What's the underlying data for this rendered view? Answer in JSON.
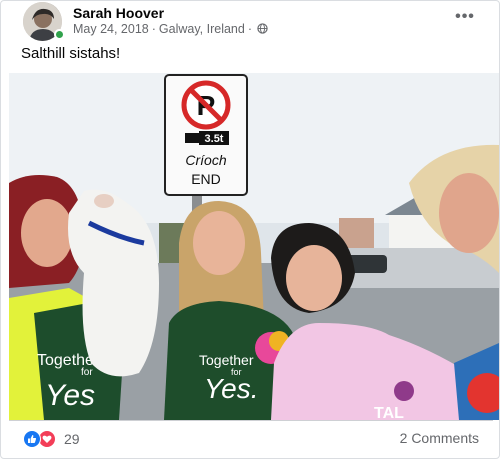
{
  "post": {
    "author": "Sarah Hoover",
    "date": "May 24, 2018",
    "separator": "·",
    "location": "Galway, Ireland",
    "caption": "Salthill sistahs!",
    "more_menu": "•••",
    "icons": [
      "avatar",
      "online-indicator",
      "globe-icon",
      "more-options-icon",
      "like-icon",
      "love-icon"
    ]
  },
  "photo": {
    "sign": {
      "tonnage": "3.5t",
      "line1": "Críoch",
      "line2": "END"
    },
    "shirt_left": [
      "Together",
      "for",
      "Yes"
    ],
    "shirt_middle": [
      "Together",
      "for",
      "Yes."
    ],
    "shirt_right": "TAL"
  },
  "footer": {
    "reaction_count": "29",
    "comments": "2 Comments"
  },
  "colors": {
    "brand_blue": "#1877f2",
    "love_red": "#f33e58",
    "online_green": "#31a24c",
    "secondary_text": "#65676b",
    "yes_green": "#1e4d2b"
  }
}
